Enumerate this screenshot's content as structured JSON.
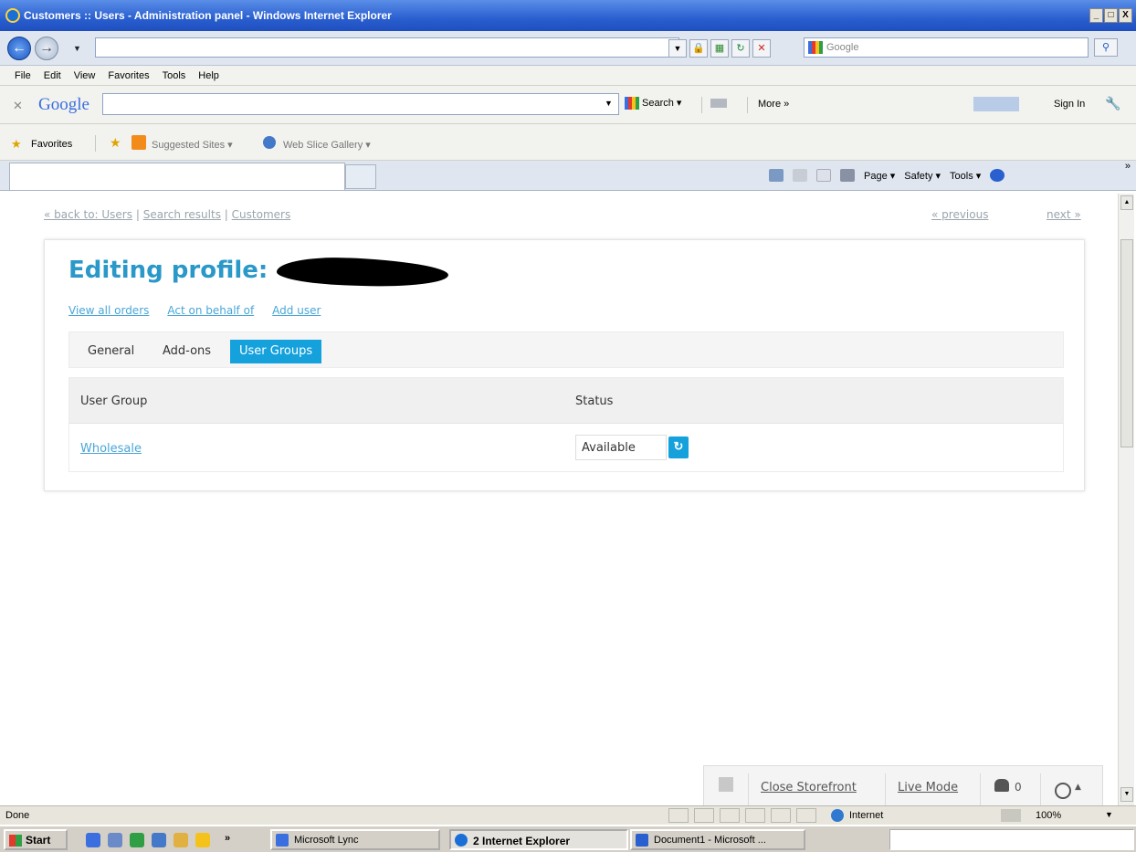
{
  "window": {
    "title": "Customers :: Users - Administration panel - Windows Internet Explorer",
    "controls": [
      "_",
      "□",
      "X"
    ]
  },
  "address_bar": {
    "search_placeholder": "Google"
  },
  "menu": [
    "File",
    "Edit",
    "View",
    "Favorites",
    "Tools",
    "Help"
  ],
  "google_toolbar": {
    "logo": "Google",
    "search_label": "Search",
    "more_label": "More »",
    "signin_label": "Sign In"
  },
  "favorites_bar": {
    "favorites_label": "Favorites",
    "suggested_sites": "Suggested Sites ▾",
    "web_slice_gallery": "Web Slice Gallery ▾"
  },
  "command_bar": {
    "page_label": "Page ▾",
    "safety_label": "Safety ▾",
    "tools_label": "Tools ▾"
  },
  "breadcrumbs": {
    "back_to": "« back to: Users",
    "sep1": "|",
    "search_results": "Search results",
    "sep2": "|",
    "customers": "Customers"
  },
  "pager": {
    "previous": "« previous",
    "next": "next »"
  },
  "profile": {
    "title": "Editing profile:",
    "links": [
      "View all orders",
      "Act on behalf of",
      "Add user"
    ],
    "tabs": [
      "General",
      "Add-ons",
      "User Groups"
    ],
    "active_tab": "User Groups"
  },
  "user_groups_table": {
    "headers": [
      "User Group",
      "Status"
    ],
    "rows": [
      {
        "group": "Wholesale",
        "status": "Available"
      }
    ]
  },
  "bottom_bar": {
    "close_storefront": "Close Storefront",
    "live_mode": "Live Mode",
    "users_online": "0"
  },
  "status_bar": {
    "status": "Done",
    "zone": "Internet",
    "zoom": "100%"
  },
  "taskbar": {
    "start": "Start",
    "buttons": [
      "Microsoft Lync",
      "2 Internet Explorer",
      "Document1 - Microsoft ..."
    ]
  },
  "colors": {
    "accent": "#15a1dc",
    "title": "#2a98c8",
    "link": "#4aa6d8"
  }
}
